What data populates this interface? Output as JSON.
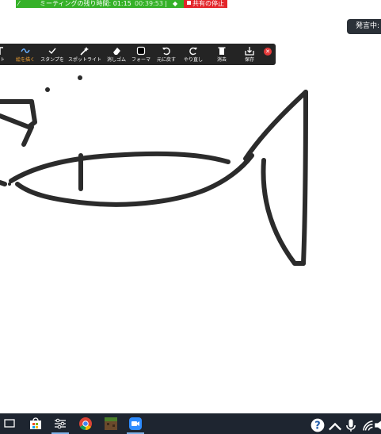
{
  "meeting_bar": {
    "remaining_label": "ミーティングの残り時間: 01:15",
    "elapsed": "00:39:53",
    "stop_share_label": "共有の停止"
  },
  "speaker": {
    "label": "発言中:"
  },
  "toolbar": {
    "tools": [
      {
        "label": "スト",
        "icon": "text-icon"
      },
      {
        "label": "絵を描く",
        "icon": "draw-icon",
        "active": true
      },
      {
        "label": "スタンプを",
        "icon": "stamp-check-icon"
      },
      {
        "label": "スポットライト",
        "icon": "spotlight-wand-icon"
      },
      {
        "label": "消しゴム",
        "icon": "eraser-icon"
      },
      {
        "label": "フォーマ",
        "icon": "format-square-icon"
      },
      {
        "label": "元に戻す",
        "icon": "undo-icon"
      },
      {
        "label": "やり直し",
        "icon": "redo-icon"
      },
      {
        "label": "消去",
        "icon": "trash-icon"
      },
      {
        "label": "保存",
        "icon": "save-icon"
      }
    ],
    "accent_color": "#f0a030",
    "close_color": "#e53a3a"
  },
  "taskbar": {
    "apps": [
      "task-view-icon",
      "store-icon",
      "settings-icon",
      "chrome-icon",
      "minecraft-icon",
      "zoom-icon"
    ],
    "tray": [
      "help-icon",
      "chevron-up-icon",
      "microphone-icon",
      "wifi-icon",
      "volume-icon"
    ]
  }
}
